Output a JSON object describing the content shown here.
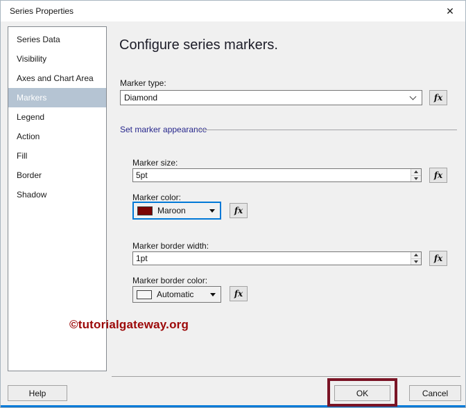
{
  "window": {
    "title": "Series Properties",
    "close_icon": "✕",
    "accent_bottom_color": "#0079d8"
  },
  "sidebar": {
    "items": [
      {
        "label": "Series Data",
        "selected": false
      },
      {
        "label": "Visibility",
        "selected": false
      },
      {
        "label": "Axes and Chart Area",
        "selected": false
      },
      {
        "label": "Markers",
        "selected": true
      },
      {
        "label": "Legend",
        "selected": false
      },
      {
        "label": "Action",
        "selected": false
      },
      {
        "label": "Fill",
        "selected": false
      },
      {
        "label": "Border",
        "selected": false
      },
      {
        "label": "Shadow",
        "selected": false
      }
    ]
  },
  "main": {
    "heading": "Configure series markers.",
    "fx_icon": "fx",
    "marker_type": {
      "label": "Marker type:",
      "value": "Diamond"
    },
    "appearance_section": {
      "label": "Set marker appearance"
    },
    "marker_size": {
      "label": "Marker size:",
      "value": "5pt"
    },
    "marker_color": {
      "label": "Marker color:",
      "value": "Maroon",
      "swatch_color": "#7b0404",
      "focus_border_color": "#0078d7"
    },
    "marker_border_width": {
      "label": "Marker border width:",
      "value": "1pt"
    },
    "marker_border_color": {
      "label": "Marker border color:",
      "value": "Automatic",
      "swatch_color": "#f7f7f7"
    },
    "watermark": {
      "text": "©tutorialgateway.org",
      "color": "#9c0808"
    }
  },
  "footer": {
    "help_label": "Help",
    "ok_label": "OK",
    "cancel_label": "Cancel",
    "ok_highlight_color": "#7a1425"
  }
}
